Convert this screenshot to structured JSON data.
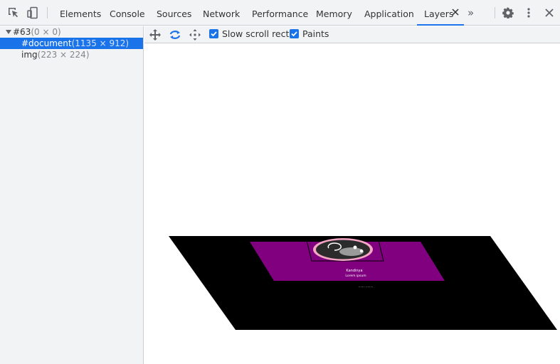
{
  "tabs": [
    {
      "label": "Elements"
    },
    {
      "label": "Console"
    },
    {
      "label": "Sources"
    },
    {
      "label": "Network"
    },
    {
      "label": "Performance"
    },
    {
      "label": "Memory"
    },
    {
      "label": "Application"
    },
    {
      "label": "Layers"
    }
  ],
  "active_tab": "Layers",
  "more_tabs_glyph": "»",
  "icons": [
    "inspect-element-icon",
    "device-toolbar-icon",
    "close-tab-icon",
    "settings-gear-icon",
    "more-options-icon",
    "close-devtools-icon",
    "pan-mode-icon",
    "rotate-mode-icon",
    "reset-transform-icon"
  ],
  "layer_tree": {
    "root": {
      "name": "#63",
      "size": "(0 × 0)"
    },
    "items": [
      {
        "name": "#document",
        "size": "(1135 × 912)",
        "selected": true
      },
      {
        "name": "img",
        "size": "(223 × 224)",
        "selected": false
      }
    ]
  },
  "layer_toolbar": {
    "slow_scroll_rects": {
      "label": "Slow scroll rects",
      "checked": true
    },
    "paints": {
      "label": "Paints",
      "checked": true
    }
  },
  "colors": {
    "accent": "#1a73e8",
    "panel_bg": "#f1f3f4",
    "layer_black": "#000000",
    "layer_purple": "#800080"
  },
  "viewport_page": {
    "heading_line_1": "Kandinya",
    "heading_line_2": "Lorem ipsum",
    "footer_text": "....... ........"
  }
}
